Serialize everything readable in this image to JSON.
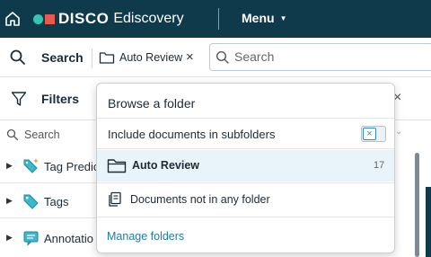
{
  "header": {
    "brand": "DISCO",
    "product": "Ediscovery",
    "menu_label": "Menu",
    "colors": {
      "bar": "#0e3a4c",
      "logo_dot": "#36c4b4",
      "logo_square": "#e8584f"
    }
  },
  "search_bar": {
    "label": "Search",
    "folder_chip": "Auto Review",
    "chip_close": "×",
    "placeholder": "Search"
  },
  "filters": {
    "label": "Filters",
    "close": "×",
    "search_placeholder": "Search",
    "items": [
      {
        "label": "Tag Predic",
        "icon": "tag-sparkle-icon"
      },
      {
        "label": "Tags",
        "icon": "tag-icon"
      },
      {
        "label": "Annotatio",
        "icon": "annotation-icon"
      }
    ]
  },
  "popover": {
    "title": "Browse a folder",
    "include_label": "Include documents in subfolders",
    "toggle_mark": "×",
    "folder_name": "Auto Review",
    "folder_count": "17",
    "no_folder_label": "Documents not in any folder",
    "manage_label": "Manage folders",
    "accent": "#1f7ca3"
  }
}
